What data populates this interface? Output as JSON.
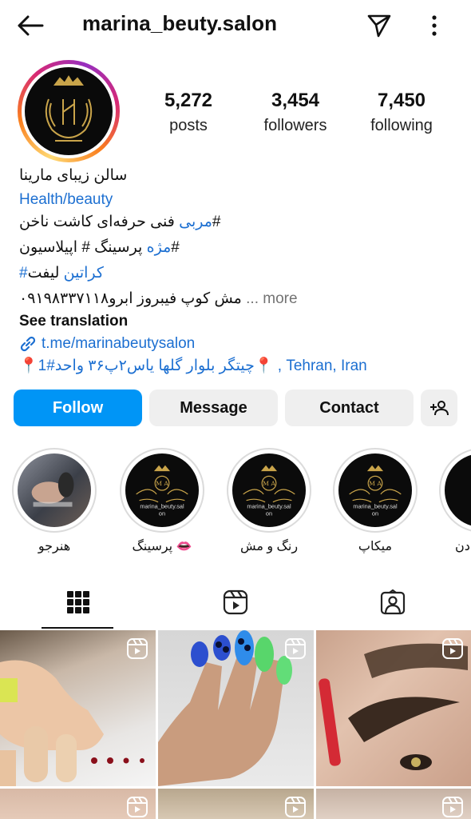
{
  "header": {
    "username": "marina_beuty.salon"
  },
  "stats": [
    {
      "value": "5,272",
      "label": "posts"
    },
    {
      "value": "3,454",
      "label": "followers"
    },
    {
      "value": "7,450",
      "label": "following"
    }
  ],
  "bio": {
    "name": "سالن زیبای مارینا",
    "category": "Health/beauty",
    "line1_blue": "مربی",
    "line1_text": "فنی حرفه‌ای کاشت ناخن#",
    "line2_text": "پرسینگ # اپیلاسیون#",
    "line2_blue": "مژه",
    "line3_text": "لیفت ",
    "line3_blue": "#کراتین",
    "line4_text": "۰۹۱۹۸۳۳۷۱۱۸مش کوپ فیبروز ابرو",
    "line4_more": "... more",
    "see_translation": "See translation",
    "link": "t.me/marinabeutysalon",
    "location": "📍چیتگر بلوار گلها یاس۲پ۳۶ واحد#1📍 , Tehran, Iran"
  },
  "buttons": {
    "follow": "Follow",
    "message": "Message",
    "contact": "Contact"
  },
  "highlights": [
    {
      "label": "هنرجو"
    },
    {
      "label": "پرسینگ 👄"
    },
    {
      "label": "رنگ و مش"
    },
    {
      "label": "میکاپ"
    },
    {
      "label": "دن"
    }
  ],
  "highlight_logo": {
    "initials": "M A",
    "text": "marina_beuty.sal\non"
  },
  "tabs": [
    {
      "name": "grid-icon",
      "active": true
    },
    {
      "name": "reels-icon",
      "active": false
    },
    {
      "name": "tagged-icon",
      "active": false
    }
  ],
  "colors": {
    "accent": "#0095f6",
    "link": "#1c6fd1",
    "gold": "#c9a44a"
  }
}
